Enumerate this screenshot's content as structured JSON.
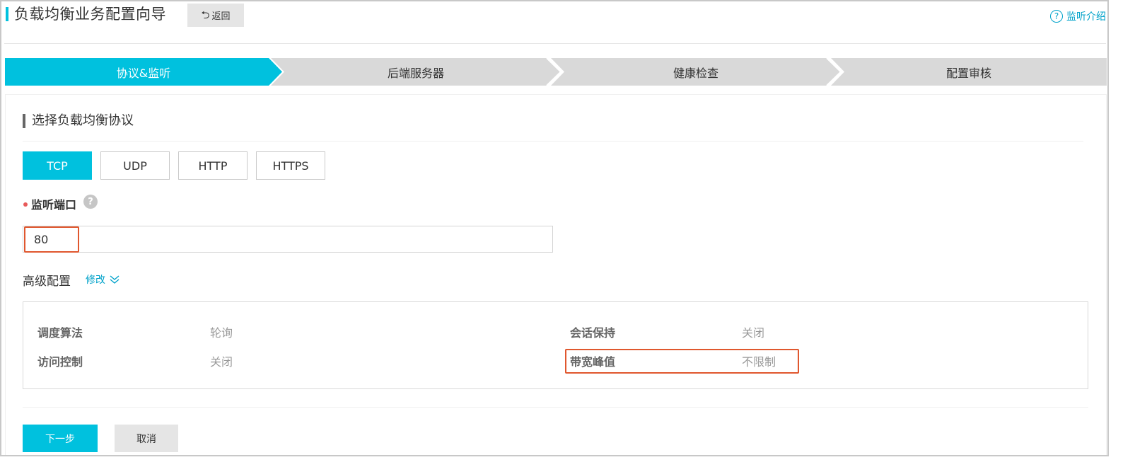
{
  "header": {
    "title": "负载均衡业务配置向导",
    "back_label": "返回",
    "back_icon": "undo-arrow-icon",
    "help_label": "监听介绍",
    "help_icon": "question-circle-icon"
  },
  "steps": [
    {
      "label": "协议&监听",
      "active": true
    },
    {
      "label": "后端服务器",
      "active": false
    },
    {
      "label": "健康检查",
      "active": false
    },
    {
      "label": "配置审核",
      "active": false
    }
  ],
  "protocol_section": {
    "title": "选择负载均衡协议",
    "options": [
      "TCP",
      "UDP",
      "HTTP",
      "HTTPS"
    ],
    "selected": "TCP"
  },
  "listen_port": {
    "label": "监听端口",
    "help_icon": "question-mark-icon",
    "value": "80"
  },
  "advanced": {
    "label": "高级配置",
    "modify_label": "修改",
    "modify_icon": "double-chevron-down-icon",
    "items": [
      {
        "key": "调度算法",
        "value": "轮询"
      },
      {
        "key": "会话保持",
        "value": "关闭"
      },
      {
        "key": "访问控制",
        "value": "关闭"
      },
      {
        "key": "带宽峰值",
        "value": "不限制"
      }
    ]
  },
  "actions": {
    "next_label": "下一步",
    "cancel_label": "取消"
  },
  "colors": {
    "accent": "#00c1de",
    "link": "#00a2ca",
    "step_inactive": "#d9d9d9",
    "highlight": "#e0572e",
    "required": "#e85a5a"
  }
}
